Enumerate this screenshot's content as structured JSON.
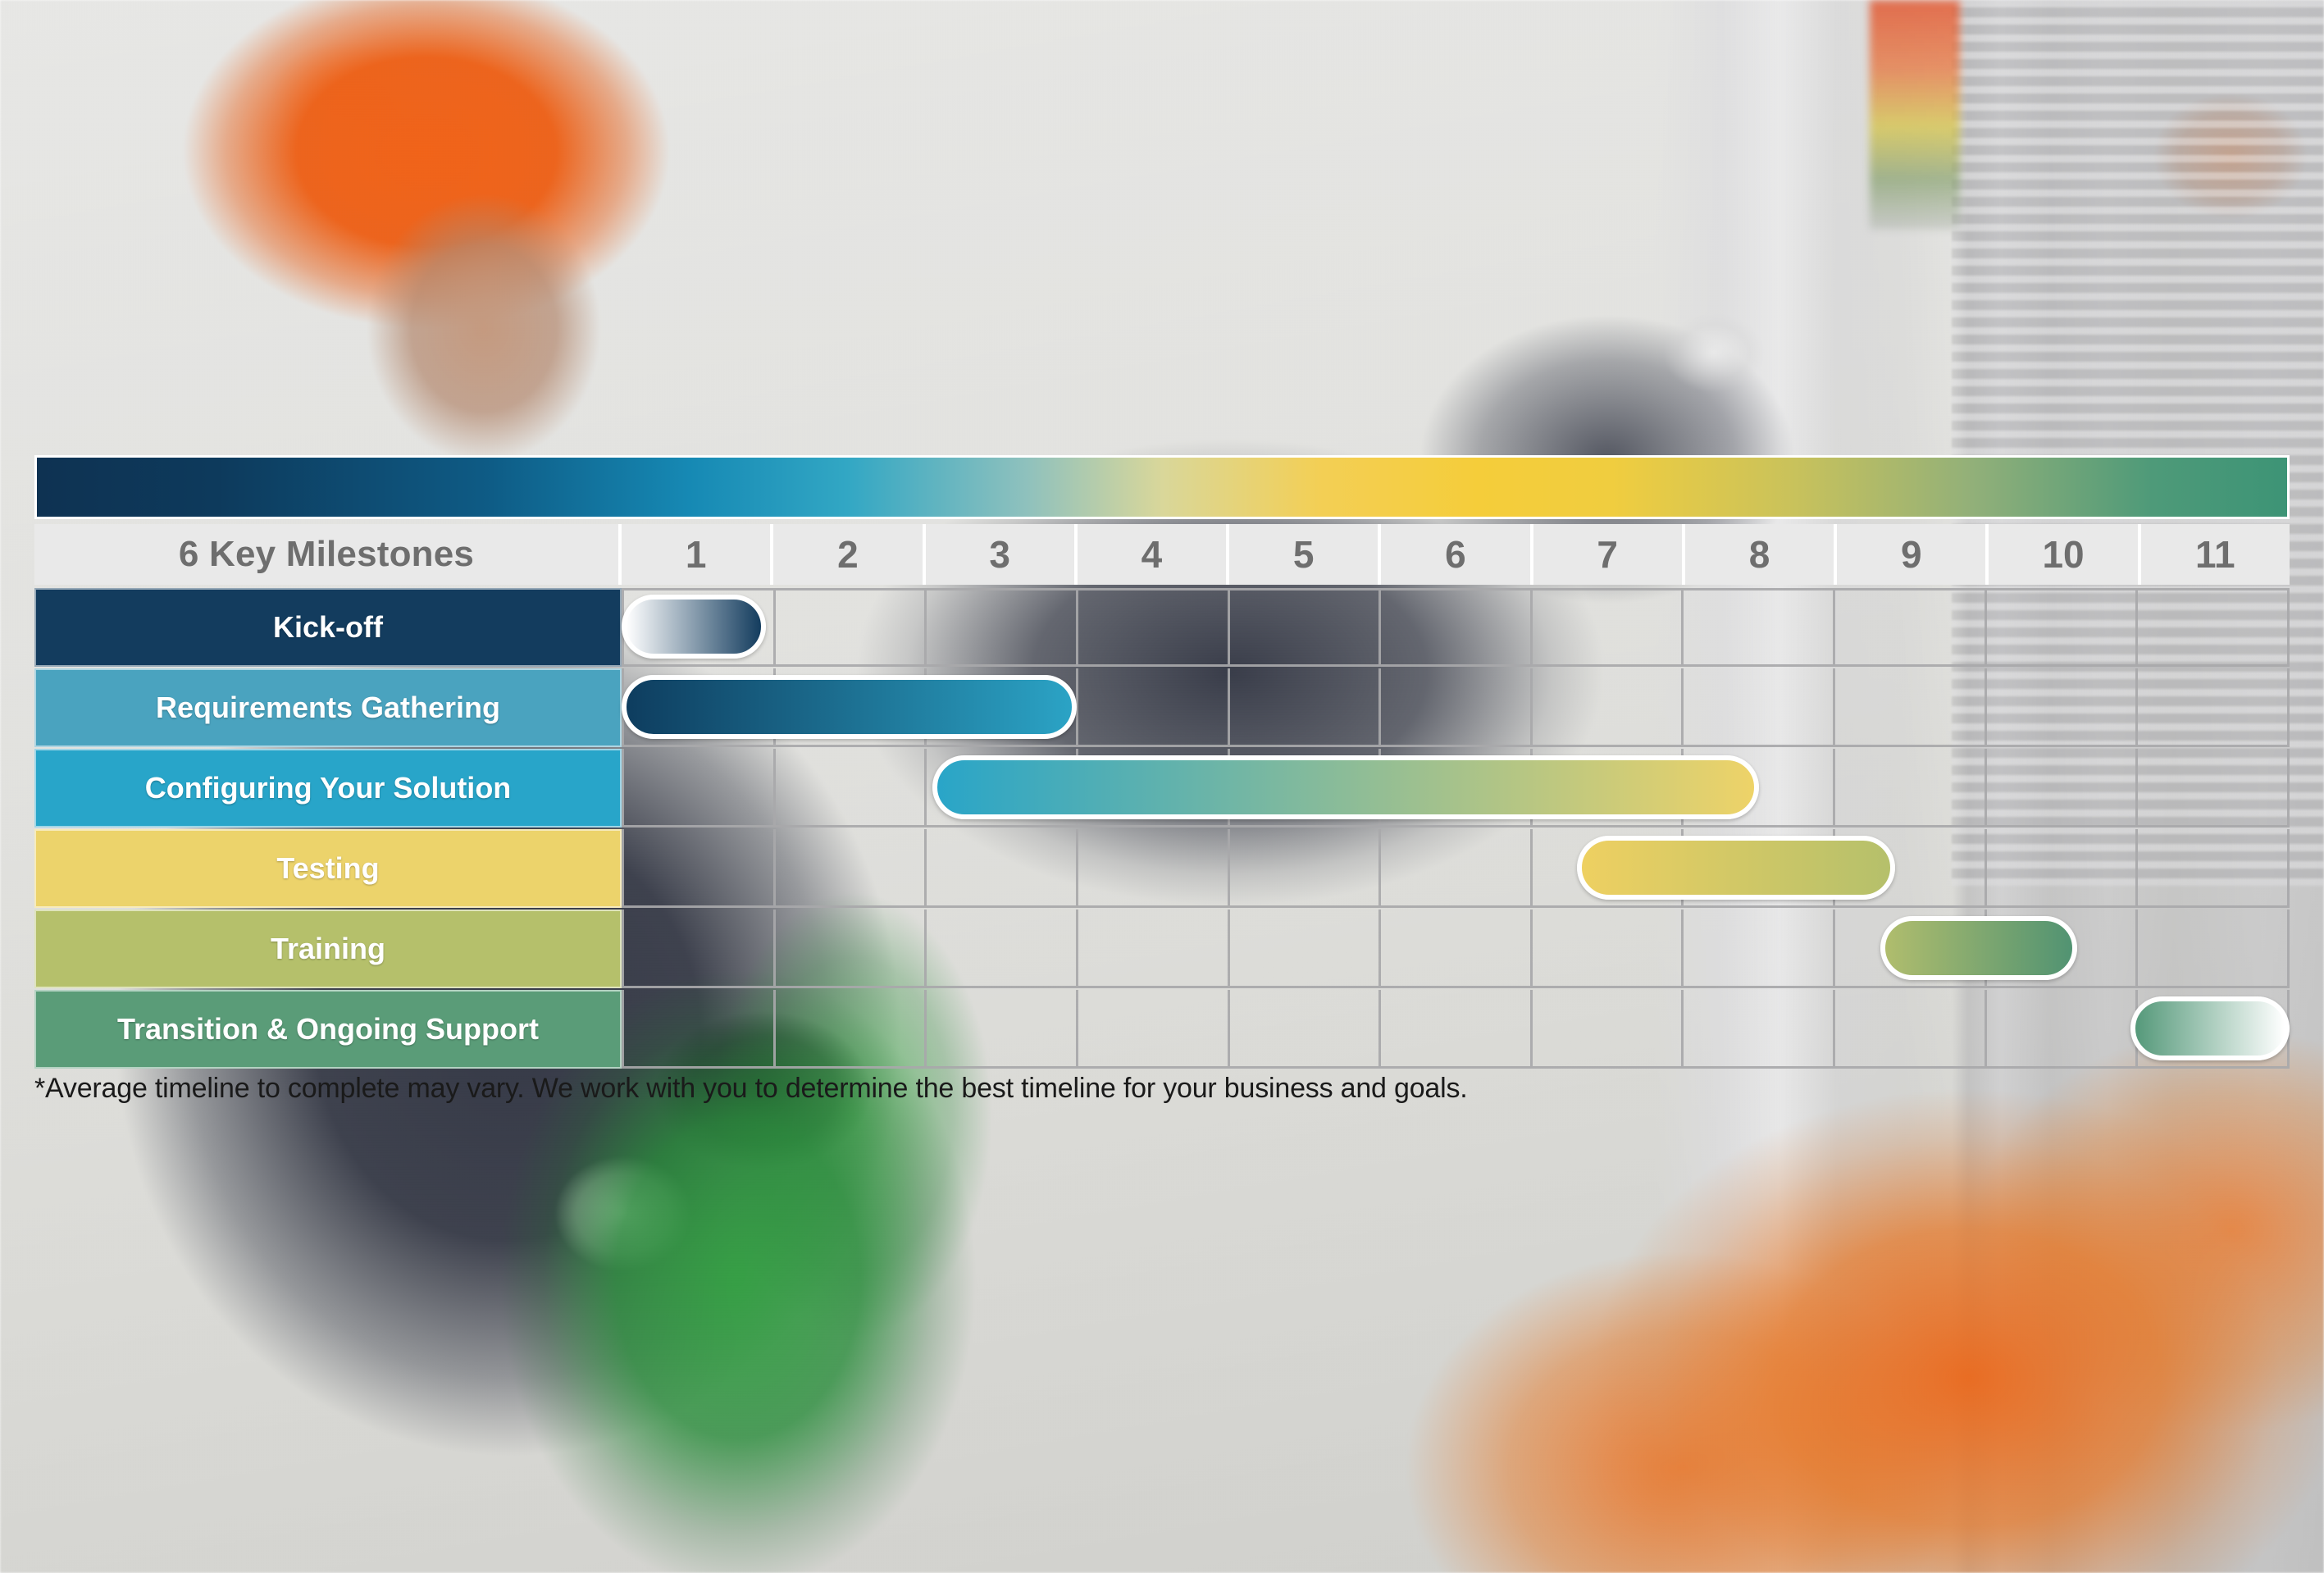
{
  "header": {
    "label_column_title": "6 Key Milestones"
  },
  "footnote": "*Average timeline to complete may vary. We work with you to determine the best timeline for your business and goals.",
  "colors": {
    "kickoff": "#133c5e",
    "requirements": "#4aa3bf",
    "configuring": "#28a5c9",
    "testing": "#ecd36b",
    "training": "#b5c06b",
    "transition": "#5a9c78",
    "grid_line": "#a8a8aa",
    "header_cell_bg": "#e9e9e9",
    "header_text": "#6e6e6e",
    "bar_outline": "#ffffff"
  },
  "chart_data": {
    "type": "bar",
    "chart_kind": "gantt",
    "title": "6 Key Milestones",
    "xlabel": "",
    "ylabel": "",
    "x_unit": "month",
    "categories": [
      "1",
      "2",
      "3",
      "4",
      "5",
      "6",
      "7",
      "8",
      "9",
      "10",
      "11"
    ],
    "xlim": [
      0,
      11
    ],
    "grid": true,
    "legend": "none",
    "annotations": [
      "*Average timeline to complete may vary. We work with you to determine the best timeline for your business and goals."
    ],
    "tasks": [
      {
        "name": "Kick-off",
        "start": 0.0,
        "end": 0.95,
        "row_color": "#133c5e",
        "bar_gradient_from": "#ffffff",
        "bar_gradient_to": "#133c5e"
      },
      {
        "name": "Requirements Gathering",
        "start": 0.0,
        "end": 3.0,
        "row_color": "#4aa3bf",
        "bar_gradient_from": "#0e3d5f",
        "bar_gradient_to": "#2ba3c5"
      },
      {
        "name": "Configuring Your Solution",
        "start": 2.05,
        "end": 7.5,
        "row_color": "#28a5c9",
        "bar_gradient_from": "#29a5c8",
        "bar_gradient_to": "#eed368"
      },
      {
        "name": "Testing",
        "start": 6.3,
        "end": 8.4,
        "row_color": "#ecd36b",
        "bar_gradient_from": "#eed061",
        "bar_gradient_to": "#b5c06b"
      },
      {
        "name": "Training",
        "start": 8.3,
        "end": 9.6,
        "row_color": "#b5c06b",
        "bar_gradient_from": "#b0bd6d",
        "bar_gradient_to": "#519372"
      },
      {
        "name": "Transition & Ongoing Support",
        "start": 9.95,
        "end": 11.0,
        "row_color": "#5a9c78",
        "bar_gradient_from": "#55997a",
        "bar_gradient_to": "#ffffff"
      }
    ]
  }
}
